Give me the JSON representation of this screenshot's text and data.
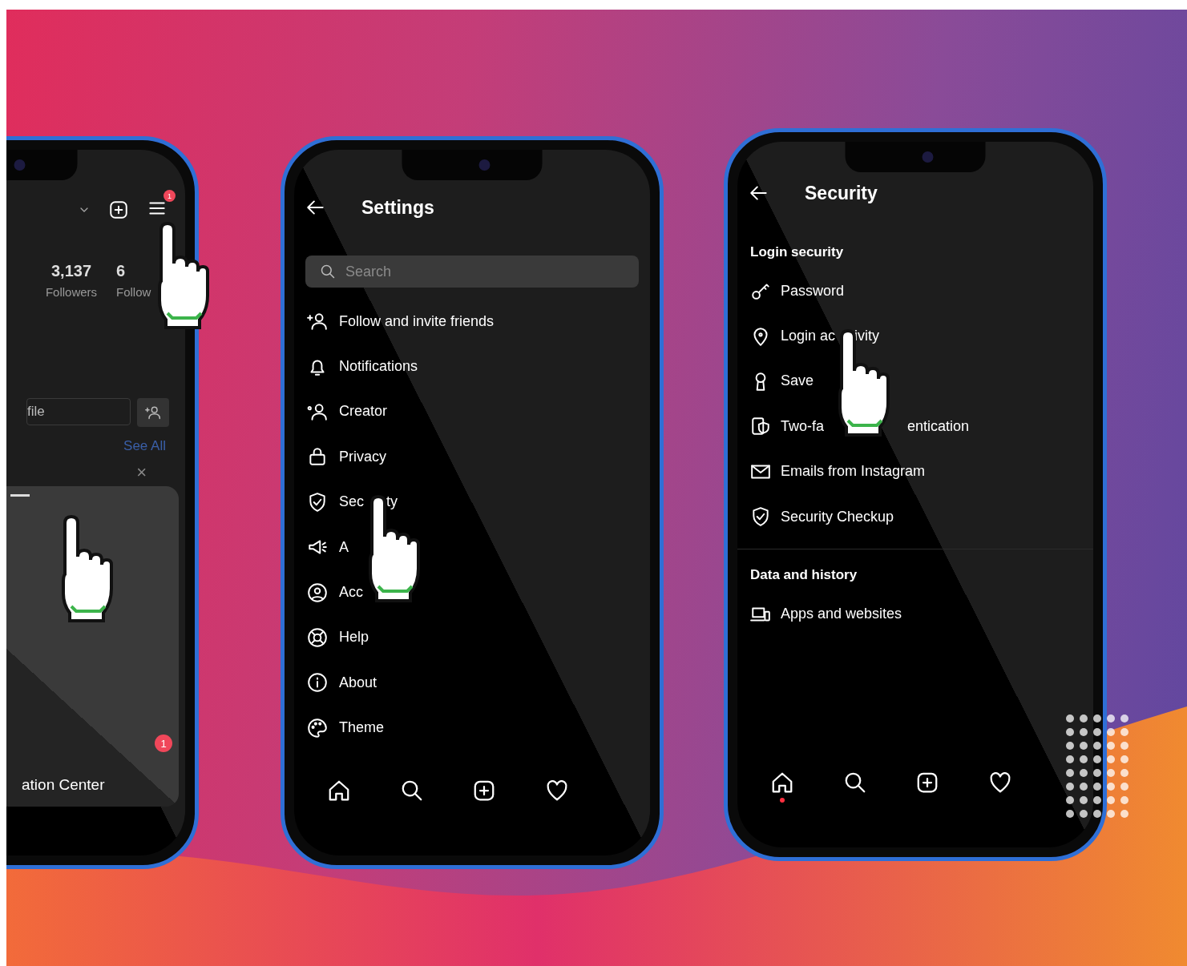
{
  "profile_phone": {
    "menu_badge": "1",
    "menu_pointer": true,
    "stats": [
      {
        "value": "3,137",
        "label": "Followers"
      },
      {
        "value": "6",
        "label": "Follow"
      }
    ],
    "field_value": "file",
    "see_all": "See All",
    "close": "×",
    "panel_pointer": true,
    "panel_badge": "1",
    "panel_text": "ation Center"
  },
  "settings_phone": {
    "title": "Settings",
    "search": {
      "placeholder": "Search"
    },
    "items": [
      {
        "label": "Follow and invite friends",
        "pointer": false
      },
      {
        "label": "Notifications",
        "pointer": false
      },
      {
        "label": "Creator",
        "pointer": false
      },
      {
        "label": "Privacy",
        "pointer": false
      },
      {
        "label": "Sec",
        "label_end": "ty",
        "pointer": true
      },
      {
        "label": "A",
        "pointer": false
      },
      {
        "label": "Acc",
        "pointer": false
      },
      {
        "label": "Help",
        "pointer": false
      },
      {
        "label": "About",
        "pointer": false
      },
      {
        "label": "Theme",
        "pointer": false
      }
    ],
    "nav_dot": false
  },
  "security_phone": {
    "title": "Security",
    "sections": [
      {
        "heading": "Login security",
        "items": [
          {
            "label": "Password",
            "pointer": false
          },
          {
            "label": "Login ac",
            "label_end": "ivity",
            "pointer": true
          },
          {
            "label": "Save",
            "pointer": false
          },
          {
            "label": "Two-fa",
            "label_end": "entication",
            "pointer": false
          },
          {
            "label": "Emails from Instagram",
            "pointer": false
          },
          {
            "label": "Security Checkup",
            "pointer": false
          }
        ]
      },
      {
        "heading": "Data and history",
        "items": [
          {
            "label": "Apps and websites",
            "pointer": false
          }
        ]
      }
    ],
    "nav_dot": true
  }
}
